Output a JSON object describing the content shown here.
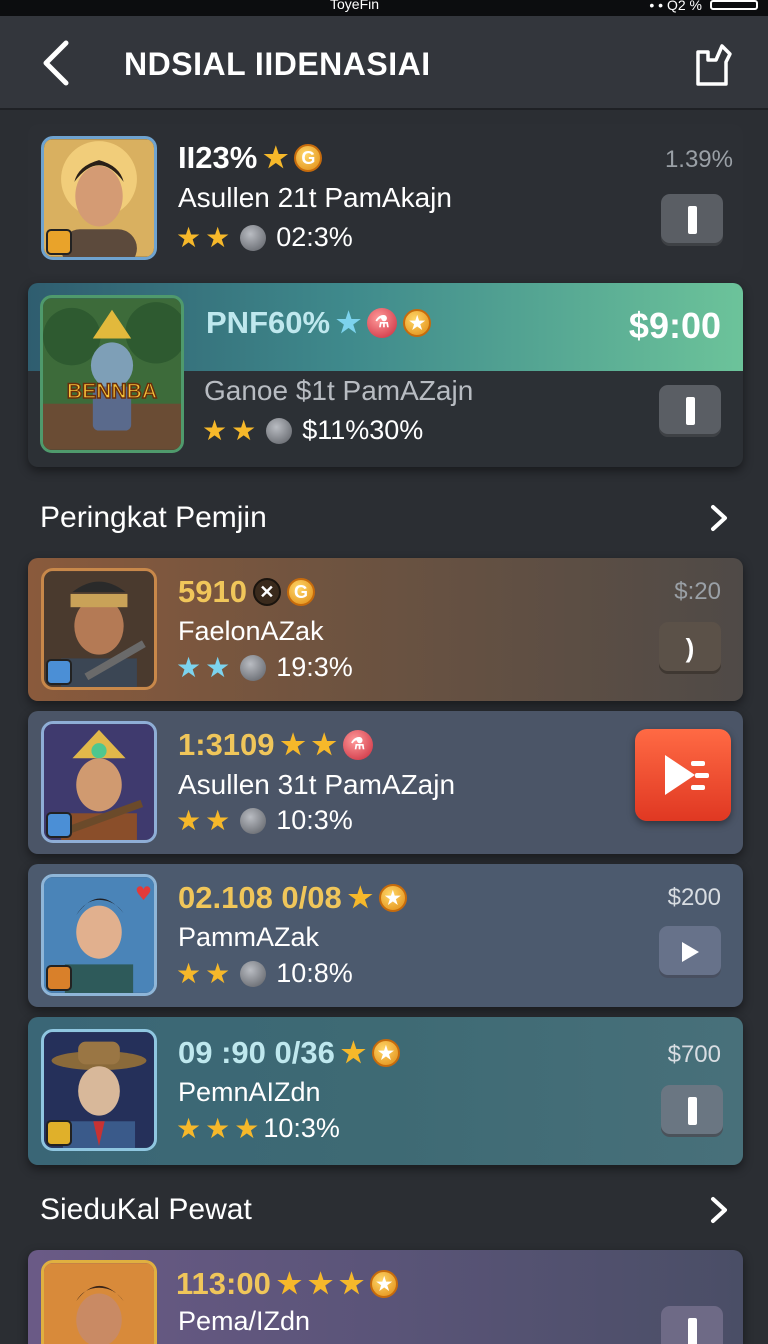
{
  "status_bar": {
    "center": "ToyeFin",
    "right": "• • Q2 %"
  },
  "header": {
    "title": "NDSIAL IIDENASIAI"
  },
  "featured": [
    {
      "stat": "II23%",
      "name": "Asullen 21t PamAkajn",
      "rating_text": "02:3%",
      "price": "1.39%",
      "thumb": "hero-portrait"
    },
    {
      "stat": "PNF60%",
      "name": "Ganoe $1t PamAZajn",
      "rating_text": "$11%30%",
      "price": "$9:00",
      "thumb": "warrior-game-art",
      "thumb_label": "BENNBA"
    }
  ],
  "sections": [
    {
      "title": "Peringkat Pemjin",
      "items": [
        {
          "stat": "5910",
          "name": "FaelonAZak",
          "rating_text": "19:3%",
          "price": "$:20",
          "ctrl": ")"
        },
        {
          "stat": "1:3109",
          "name": "Asullen 31t PamAZajn",
          "rating_text": "10:3%",
          "action": "play-video"
        },
        {
          "stat": "02.108 0/08",
          "name": "PammAZak",
          "rating_text": "10:8%",
          "price": "$200",
          "ctrl": "play"
        },
        {
          "stat": "09 :90 0/36",
          "name": "PemnAIZdn",
          "rating_text": "10:3%",
          "price": "$700",
          "ctrl": "bar"
        }
      ]
    },
    {
      "title": "SieduKal Pewat",
      "items": [
        {
          "stat": "113:00",
          "name": "Pema/IZdn"
        }
      ]
    }
  ],
  "colors": {
    "background": "#2b2e33",
    "gold": "#f6b82a",
    "accent_red": "#ee4a2c",
    "teal_banner": "#5fb7a2"
  }
}
